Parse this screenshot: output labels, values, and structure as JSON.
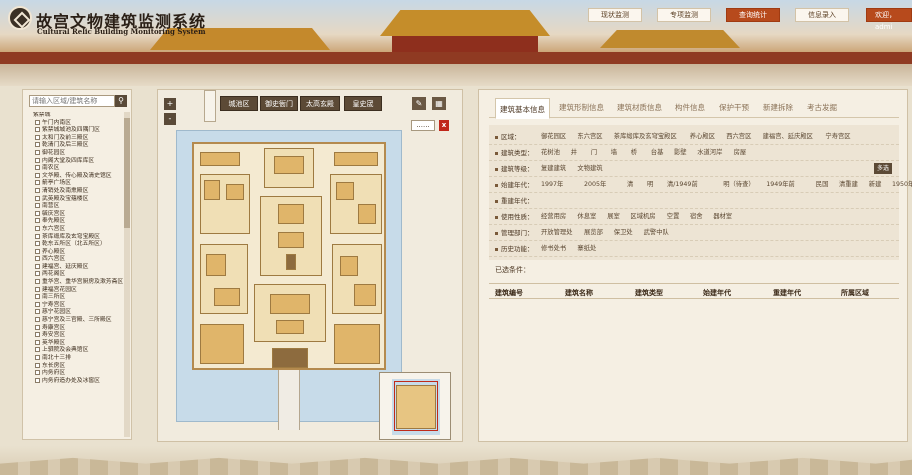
{
  "header": {
    "title_cn": "故宫文物建筑监测系统",
    "title_en": "Cultural Relic Building Monitoring System",
    "nav": [
      "现状监测",
      "专项监测",
      "查询统计",
      "信息录入"
    ],
    "active_nav": "查询统计",
    "user": "欢迎，admi"
  },
  "search": {
    "placeholder": "请输入区域/建筑名称",
    "button_icon": "search-icon"
  },
  "tree": {
    "root": "紫禁城",
    "items": [
      "午门内南区",
      "紫禁城城池及四隅门区",
      "太和门及前三殿区",
      "乾清门及后三殿区",
      "御花园区",
      "内阁大堂及四库库区",
      "南农区",
      "文华殿、传心殿及清史馆区",
      "箭亭广场区",
      "清销处及南熏殿区",
      "武英殿及宝蕴楼区",
      "南营区",
      "毓庆宫区",
      "奉先殿区",
      "东六宫区",
      "茶库缎库及玄穹宝殿区",
      "乾东五所区（北五所区）",
      "养心殿区",
      "西六宫区",
      "建福宫、延庆殿区",
      "两花阁区",
      "重华宫、重华宫厨房及漱芳斋区",
      "建福宫花园区",
      "南三所区",
      "宁寿宫区",
      "慈宁花园区",
      "慈宁宫及三官殿、三所殿区",
      "寿康宫区",
      "寿安宫区",
      "英华殿区",
      "上驷院及会典馆区",
      "南北十三排",
      "东长房区",
      "内务府区",
      "内务府造办处及冰窖区"
    ]
  },
  "map": {
    "tabs": [
      "城池区",
      "御史衙门",
      "太高玄殿",
      "皇史宬"
    ],
    "more_label": "......",
    "close_label": "x",
    "zoom_in": "+",
    "zoom_out": "-"
  },
  "right": {
    "tabs": [
      "建筑基本信息",
      "建筑形制信息",
      "建筑材质信息",
      "构件信息",
      "保护干预",
      "新建拆除",
      "考古发掘"
    ],
    "filters": [
      {
        "label": "区域：",
        "options": [
          "御花园区",
          "东六宫区",
          "茶库缎库及玄穹宝殿区",
          "养心殿区",
          "西六宫区",
          "建福宫、延庆殿区",
          "宁寿宫区"
        ]
      },
      {
        "label": "建筑类型：",
        "options": [
          "花树池",
          "井",
          "门",
          "墙",
          "桥",
          "台基",
          "影壁",
          "水道河岸",
          "房屋"
        ]
      },
      {
        "label": "建筑等级：",
        "options": [
          "复建建筑",
          "文物建筑"
        ]
      },
      {
        "label": "始建年代：",
        "options": [
          "1997年",
          "2005年",
          "清",
          "明",
          "清/1949前",
          "明（待查）",
          "1949年前",
          "民国",
          "清重建",
          "新建",
          "1950年前"
        ]
      },
      {
        "label": "重建年代：",
        "options": []
      },
      {
        "label": "使用性质：",
        "options": [
          "经营用房",
          "休息室",
          "展室",
          "区域机房",
          "空置",
          "宿舍",
          "器材室"
        ]
      },
      {
        "label": "管理部门：",
        "options": [
          "开放管理处",
          "展览部",
          "保卫处",
          "武警中队"
        ]
      },
      {
        "label": "历史功能：",
        "options": [
          "修书处书",
          "寨纸处"
        ]
      }
    ],
    "multi_select": "多选",
    "selected_label": "已选条件：",
    "table_headers": [
      "建筑编号",
      "建筑名称",
      "建筑类型",
      "始建年代",
      "重建年代",
      "所属区域"
    ]
  },
  "colors": {
    "accent": "#b74a1c",
    "panel": "#f5efe3",
    "dark_button": "#5c4a36"
  }
}
